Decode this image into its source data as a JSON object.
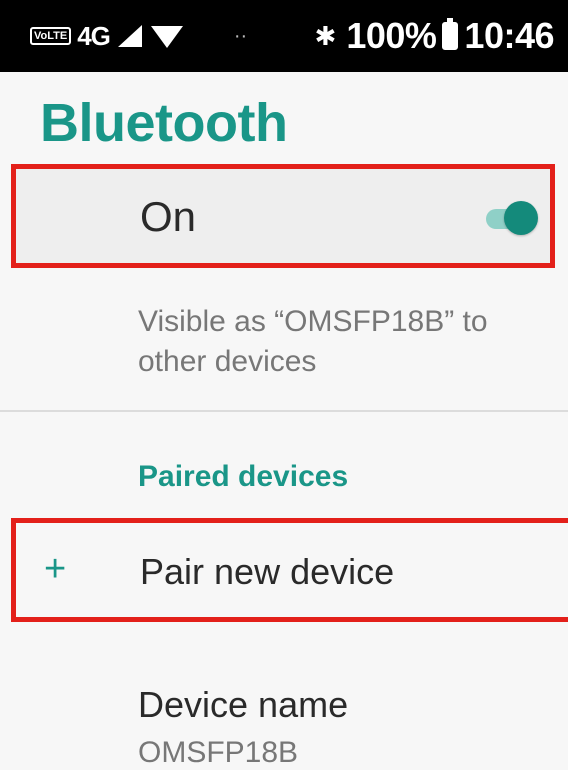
{
  "status_bar": {
    "volte": "VoLTE",
    "network": "4G",
    "bluetooth_symbol": "✱",
    "battery_percent": "100%",
    "time": "10:46"
  },
  "page": {
    "title": "Bluetooth"
  },
  "bluetooth_toggle": {
    "label": "On",
    "state": "on",
    "accent_color": "#1a9688"
  },
  "visibility_text": "Visible as “OMSFP18B” to other devices",
  "paired_section": {
    "header": "Paired devices",
    "pair_new_icon": "+",
    "pair_new_label": "Pair new device"
  },
  "device_name": {
    "label": "Device name",
    "value": "OMSFP18B"
  },
  "highlight_color": "#e3201a"
}
